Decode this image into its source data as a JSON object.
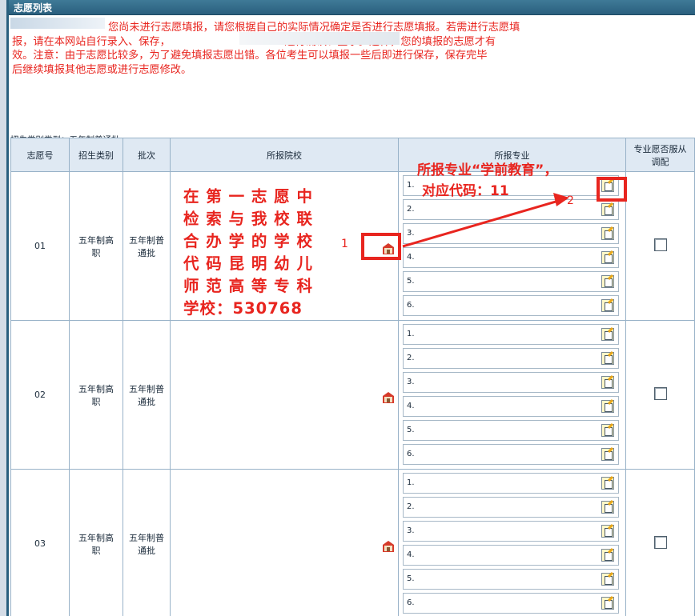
{
  "panel": {
    "title": "志愿列表"
  },
  "notice": {
    "lines": [
      "您尚未进行志愿填报，请您根据自己的实际情况确定是否进行志愿填报。若需进行志愿填",
      "报，请在本网站自行录入、保存，                                  进行确认、签字。这样，您的填报的志愿才有",
      "效。注意：由于志愿比较多，为了避免填报志愿出错。各位考生可以填报一些后即进行保存，保存完毕",
      "后继续填报其他志愿或进行志愿修改。"
    ]
  },
  "category": "招生类别类型：五年制普通批",
  "table": {
    "headers": {
      "no": "志愿号",
      "category": "招生类别",
      "batch": "批次",
      "school": "所报院校",
      "major": "所报专业",
      "adjust": "专业愿否服从调配"
    },
    "rows": [
      {
        "no": "01",
        "category": "五年制高职",
        "batch": "五年制普通批",
        "majors": [
          "1.",
          "2.",
          "3.",
          "4.",
          "5.",
          "6."
        ]
      },
      {
        "no": "02",
        "category": "五年制高职",
        "batch": "五年制普通批",
        "majors": [
          "1.",
          "2.",
          "3.",
          "4.",
          "5.",
          "6."
        ]
      },
      {
        "no": "03",
        "category": "五年制高职",
        "batch": "五年制普通批",
        "majors": [
          "1.",
          "2.",
          "3.",
          "4.",
          "5.",
          "6."
        ]
      }
    ]
  },
  "annotations": {
    "school_note": [
      "在 第 一 志 愿 中",
      "检 索 与 我 校 联",
      "合 办 学 的 学 校",
      "代 码 昆 明 幼 儿",
      "师 范 高 等 专 科",
      "学校：530768"
    ],
    "major_note": [
      "所报专业“学前教育”，",
      "对应代码：11"
    ],
    "marker_1": "1",
    "marker_2": "2"
  },
  "colors": {
    "header": "#2a5f7e",
    "notice": "#e8251f",
    "annotation": "#e8251f",
    "grid_border": "#98b2c8"
  }
}
